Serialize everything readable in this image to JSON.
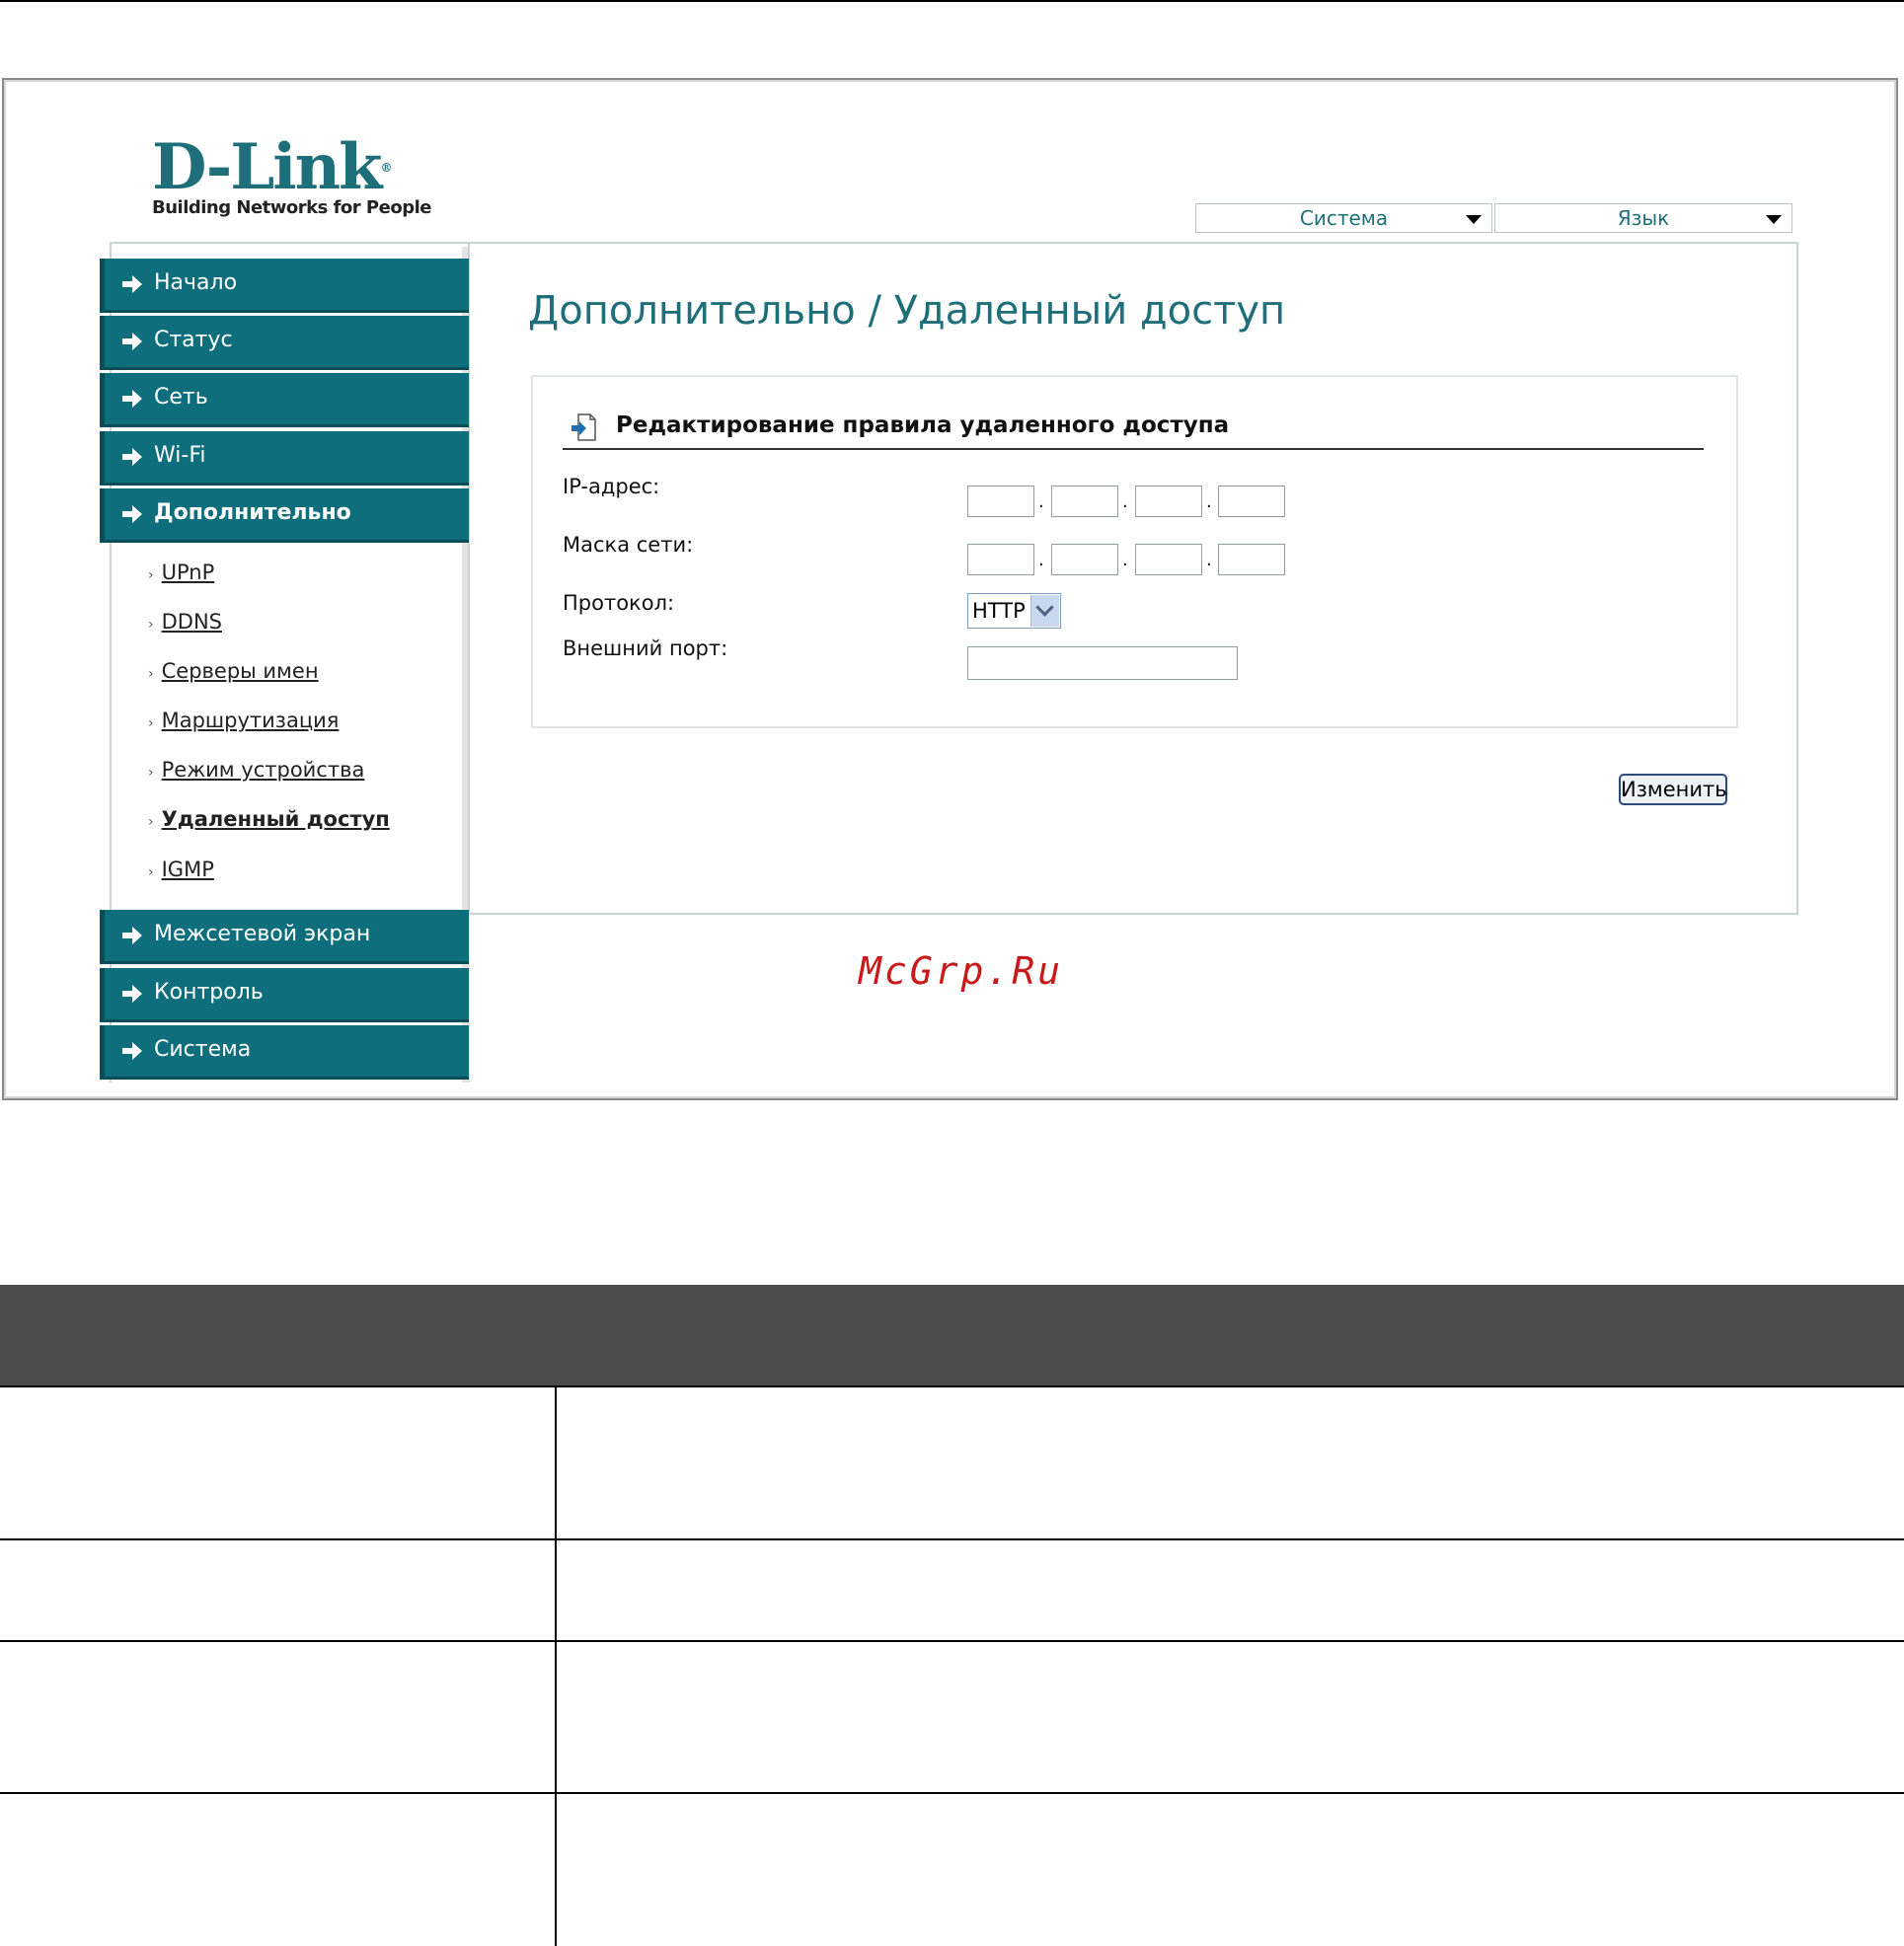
{
  "header": {
    "brand": "D-Link",
    "registered_mark": "®",
    "tagline": "Building Networks for People",
    "system_menu": "Система",
    "language_menu": "Язык"
  },
  "nav": {
    "main_items": [
      {
        "label": "Начало"
      },
      {
        "label": "Статус"
      },
      {
        "label": "Сеть"
      },
      {
        "label": "Wi-Fi"
      },
      {
        "label": "Дополнительно"
      }
    ],
    "sub_items": [
      {
        "label": "UPnP"
      },
      {
        "label": "DDNS"
      },
      {
        "label": "Серверы имен"
      },
      {
        "label": "Маршрутизация"
      },
      {
        "label": "Режим устройства"
      },
      {
        "label": "Удаленный доступ"
      },
      {
        "label": "IGMP"
      }
    ],
    "bottom_items": [
      {
        "label": "Межсетевой экран"
      },
      {
        "label": "Контроль"
      },
      {
        "label": "Система"
      }
    ]
  },
  "page": {
    "title": "Дополнительно /  Удаленный доступ",
    "section_title": "Редактирование правила удаленного доступа",
    "fields": {
      "ip_label": "IP-адрес:",
      "mask_label": "Маска сети:",
      "protocol_label": "Протокол:",
      "protocol_value": "HTTP",
      "port_label": "Внешний порт:"
    },
    "submit_label": "Изменить"
  },
  "watermark": "McGrp.Ru"
}
